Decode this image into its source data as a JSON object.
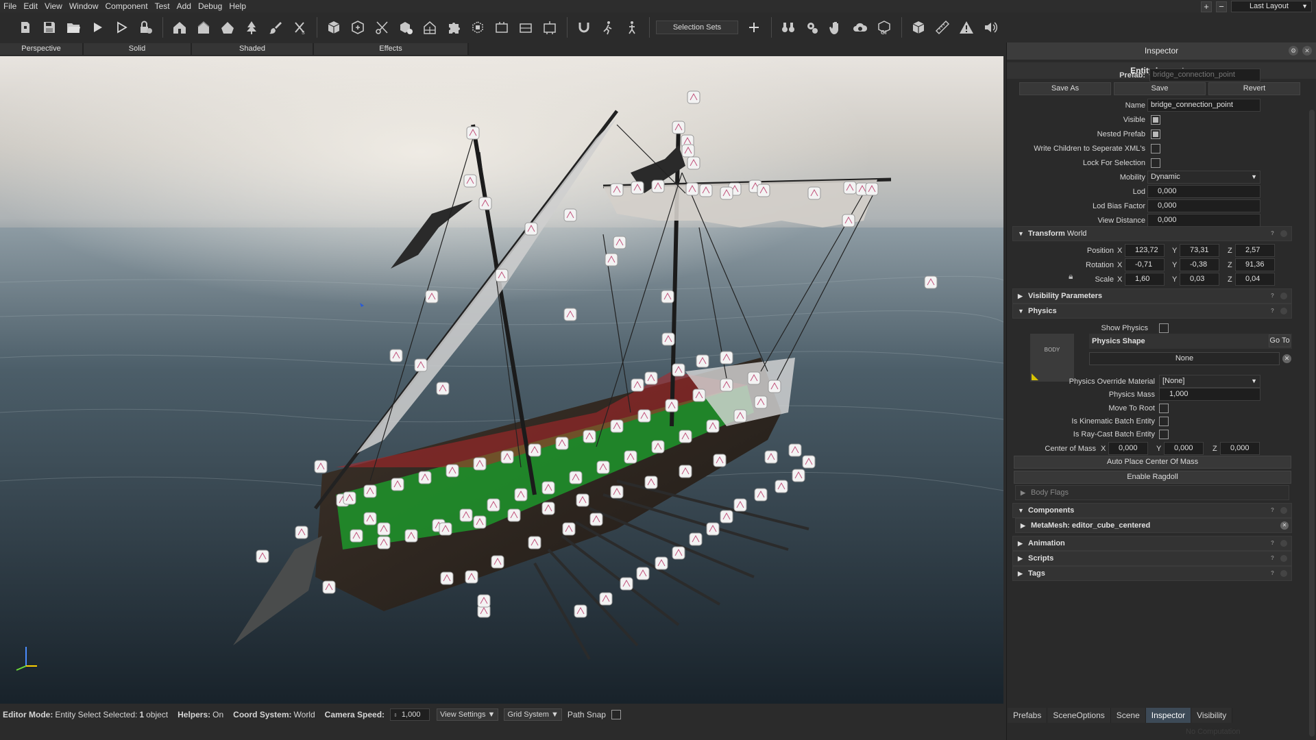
{
  "menu": [
    "File",
    "Edit",
    "View",
    "Window",
    "Component",
    "Test",
    "Add",
    "Debug",
    "Help"
  ],
  "layout": {
    "plus": "+",
    "minus": "−",
    "name": "Last Layout"
  },
  "toolbar": {
    "selection_sets": "Selection Sets",
    "add": "+",
    "icons": [
      "new-entity-icon",
      "save-icon",
      "open-folder-icon",
      "play-icon",
      "play-outline-icon",
      "lock-icon",
      "home-icon",
      "house-icon",
      "house-shape-icon",
      "tree-icon",
      "brush-icon",
      "selection-x-icon",
      "cube-icon",
      "cube-plus-icon",
      "scissors-icon",
      "cube-add-icon",
      "grid-house-icon",
      "puzzle-icon",
      "cube-select-icon",
      "frame-icon",
      "frame-alt-icon",
      "frame-link-icon",
      "magnet-icon",
      "walk-icon",
      "walk-alt-icon",
      "binoculars-icon",
      "gear-cloud-icon",
      "hand-icon",
      "cloud-icon",
      "gi-icon",
      "box-icon",
      "ruler-icon",
      "warning-icon",
      "speaker-icon"
    ]
  },
  "viewport_tabs": [
    "Perspective",
    "Solid",
    "Shaded",
    "Effects"
  ],
  "status": {
    "editor_mode_label": "Editor Mode:",
    "editor_mode_value": "Entity Select Selected:",
    "selected_count": "1",
    "selected_unit": "object",
    "helpers_label": "Helpers:",
    "helpers_value": "On",
    "coord_label": "Coord System:",
    "coord_value": "World",
    "camera_speed_label": "Camera Speed:",
    "camera_speed_value": "1,000",
    "view_settings": "View Settings",
    "grid_system": "Grid System",
    "path_snap": "Path Snap"
  },
  "inspector": {
    "title": "Inspector",
    "entity_title": "Entity Inspector",
    "prefab_label": "Prefab:",
    "prefab_value": "bridge_connection_point",
    "save_as": "Save As",
    "save": "Save",
    "revert": "Revert",
    "name_label": "Name",
    "name_value": "bridge_connection_point",
    "visible_label": "Visible",
    "visible": true,
    "nested_prefab_label": "Nested Prefab",
    "nested_prefab": true,
    "write_children_label": "Write Children to Seperate XML's",
    "write_children": false,
    "lock_selection_label": "Lock For Selection",
    "lock_selection": false,
    "mobility_label": "Mobility",
    "mobility_value": "Dynamic",
    "lod_label": "Lod",
    "lod_value": "0,000",
    "lod_bias_label": "Lod Bias Factor",
    "lod_bias_value": "0,000",
    "view_distance_label": "View Distance",
    "view_distance_value": "0,000"
  },
  "transform": {
    "title_bold": "Transform",
    "title_rest": "World",
    "position_label": "Position",
    "rotation_label": "Rotation",
    "scale_label": "Scale",
    "position": {
      "x": "123,72",
      "y": "73,31",
      "z": "2,57"
    },
    "rotation": {
      "x": "-0,71",
      "y": "-0,38",
      "z": "91,36"
    },
    "scale": {
      "x": "1,60",
      "y": "0,03",
      "z": "0,04"
    },
    "axis": {
      "x": "X",
      "y": "Y",
      "z": "Z"
    }
  },
  "sections": {
    "visibility_params": "Visibility Parameters",
    "physics": "Physics",
    "body_flags": "Body Flags",
    "components": "Components",
    "metamesh": "MetaMesh: editor_cube_centered",
    "animation": "Animation",
    "scripts": "Scripts",
    "tags": "Tags",
    "help": "?"
  },
  "physics": {
    "show_physics_label": "Show Physics",
    "show_physics": false,
    "body_thumb": "BODY",
    "shape_label": "Physics Shape",
    "go_to": "Go To",
    "shape_value": "None",
    "override_material_label": "Physics Override Material",
    "override_material_value": "[None]",
    "mass_label": "Physics Mass",
    "mass_value": "1,000",
    "move_to_root_label": "Move To Root",
    "kinematic_label": "Is Kinematic Batch Entity",
    "raycast_label": "Is Ray-Cast Batch Entity",
    "center_of_mass_label": "Center of Mass",
    "center_of_mass": {
      "x": "0,000",
      "y": "0,000",
      "z": "0,000"
    },
    "auto_place": "Auto Place Center Of Mass",
    "enable_ragdoll": "Enable Ragdoll"
  },
  "bottom_tabs": [
    "Prefabs",
    "SceneOptions",
    "Scene",
    "Inspector",
    "Visibility"
  ],
  "active_bottom_tab": "Inspector",
  "footer_note": "No Computation"
}
